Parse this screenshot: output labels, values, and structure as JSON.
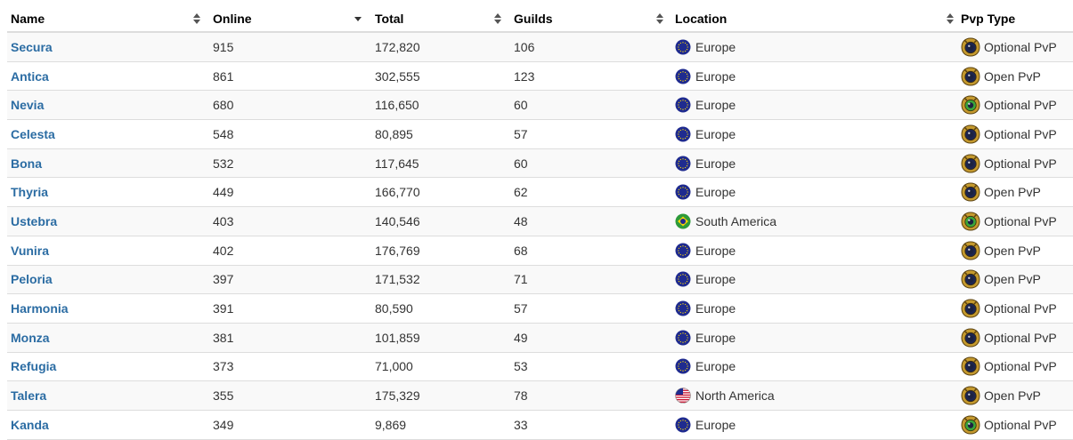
{
  "columns": {
    "name": "Name",
    "online": "Online",
    "total": "Total",
    "guilds": "Guilds",
    "location": "Location",
    "pvp_type": "Pvp Type"
  },
  "sort_icons": {
    "name": "sort-both-icon",
    "online": "sort-down-icon",
    "total": "sort-both-icon",
    "guilds": "sort-both-icon",
    "location": "sort-both-icon"
  },
  "colors": {
    "link": "#2b6ca3",
    "optional_pvp_ring": "#c59a2e",
    "open_pvp_ring": "#c59a2e",
    "optional_green": "#3aa63a",
    "eu_flag": "#1f2b8f",
    "br_flag": "#2d9a3a"
  },
  "rows": [
    {
      "name": "Secura",
      "online": "915",
      "total": "172,820",
      "guilds": "106",
      "location": "Europe",
      "flag": "eu-flag-icon",
      "pvp": "Optional PvP",
      "pvp_icon": "optional-pvp-icon"
    },
    {
      "name": "Antica",
      "online": "861",
      "total": "302,555",
      "guilds": "123",
      "location": "Europe",
      "flag": "eu-flag-icon",
      "pvp": "Open PvP",
      "pvp_icon": "open-pvp-icon"
    },
    {
      "name": "Nevia",
      "online": "680",
      "total": "116,650",
      "guilds": "60",
      "location": "Europe",
      "flag": "eu-flag-icon",
      "pvp": "Optional PvP",
      "pvp_icon": "optional-pvp-green-icon"
    },
    {
      "name": "Celesta",
      "online": "548",
      "total": "80,895",
      "guilds": "57",
      "location": "Europe",
      "flag": "eu-flag-icon",
      "pvp": "Optional PvP",
      "pvp_icon": "optional-pvp-icon"
    },
    {
      "name": "Bona",
      "online": "532",
      "total": "117,645",
      "guilds": "60",
      "location": "Europe",
      "flag": "eu-flag-icon",
      "pvp": "Optional PvP",
      "pvp_icon": "optional-pvp-icon"
    },
    {
      "name": "Thyria",
      "online": "449",
      "total": "166,770",
      "guilds": "62",
      "location": "Europe",
      "flag": "eu-flag-icon",
      "pvp": "Open PvP",
      "pvp_icon": "open-pvp-icon"
    },
    {
      "name": "Ustebra",
      "online": "403",
      "total": "140,546",
      "guilds": "48",
      "location": "South America",
      "flag": "br-flag-icon",
      "pvp": "Optional PvP",
      "pvp_icon": "optional-pvp-green-icon"
    },
    {
      "name": "Vunira",
      "online": "402",
      "total": "176,769",
      "guilds": "68",
      "location": "Europe",
      "flag": "eu-flag-icon",
      "pvp": "Open PvP",
      "pvp_icon": "open-pvp-icon"
    },
    {
      "name": "Peloria",
      "online": "397",
      "total": "171,532",
      "guilds": "71",
      "location": "Europe",
      "flag": "eu-flag-icon",
      "pvp": "Open PvP",
      "pvp_icon": "open-pvp-icon"
    },
    {
      "name": "Harmonia",
      "online": "391",
      "total": "80,590",
      "guilds": "57",
      "location": "Europe",
      "flag": "eu-flag-icon",
      "pvp": "Optional PvP",
      "pvp_icon": "optional-pvp-icon"
    },
    {
      "name": "Monza",
      "online": "381",
      "total": "101,859",
      "guilds": "49",
      "location": "Europe",
      "flag": "eu-flag-icon",
      "pvp": "Optional PvP",
      "pvp_icon": "optional-pvp-icon"
    },
    {
      "name": "Refugia",
      "online": "373",
      "total": "71,000",
      "guilds": "53",
      "location": "Europe",
      "flag": "eu-flag-icon",
      "pvp": "Optional PvP",
      "pvp_icon": "optional-pvp-icon"
    },
    {
      "name": "Talera",
      "online": "355",
      "total": "175,329",
      "guilds": "78",
      "location": "North America",
      "flag": "us-flag-icon",
      "pvp": "Open PvP",
      "pvp_icon": "open-pvp-icon"
    },
    {
      "name": "Kanda",
      "online": "349",
      "total": "9,869",
      "guilds": "33",
      "location": "Europe",
      "flag": "eu-flag-icon",
      "pvp": "Optional PvP",
      "pvp_icon": "optional-pvp-green-icon"
    }
  ]
}
